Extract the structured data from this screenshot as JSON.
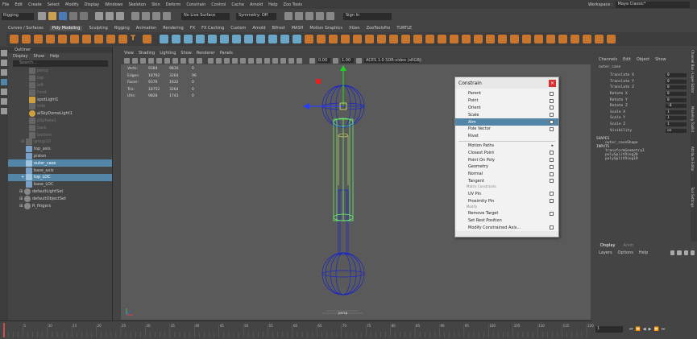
{
  "menubar": {
    "items": [
      "File",
      "Edit",
      "Create",
      "Select",
      "Modify",
      "Display",
      "Windows",
      "Skeleton",
      "Skin",
      "Deform",
      "Constrain",
      "Control",
      "Cache",
      "Arnold",
      "Help",
      "Zoo Tools"
    ],
    "workspace_label": "Workspace :",
    "workspace_value": "Maya Classic*"
  },
  "statusline": {
    "mode": "Rigging",
    "live_surface": "No Live Surface",
    "symmetry": "Symmetry: Off",
    "sign_in": "Sign In"
  },
  "shelf": {
    "tabs": [
      "Curves / Surfaces",
      "Poly Modeling",
      "Sculpting",
      "Rigging",
      "Animation",
      "Rendering",
      "FX",
      "FX Caching",
      "Custom",
      "Arnold",
      "Bifrost",
      "MASH",
      "Motion Graphics",
      "XGen",
      "ZooToolsPro",
      "TURTLE"
    ],
    "active": "Poly Modeling"
  },
  "outliner": {
    "title": "Outliner",
    "menu": [
      "Display",
      "Show",
      "Help"
    ],
    "search_placeholder": "Search...",
    "items": [
      {
        "label": "persp",
        "dim": true
      },
      {
        "label": "top",
        "dim": true
      },
      {
        "label": "left",
        "dim": true
      },
      {
        "label": "front",
        "dim": true
      },
      {
        "label": "spotLight1",
        "dim": false
      },
      {
        "label": "side",
        "dim": true
      },
      {
        "label": "aiSkyDomeLight1",
        "dim": false
      },
      {
        "label": "pSphere1",
        "dim": true
      },
      {
        "label": "back",
        "dim": true
      },
      {
        "label": "bottom",
        "dim": true
      },
      {
        "label": "group10",
        "dim": true
      },
      {
        "label": "top_axis",
        "dim": false
      },
      {
        "label": "piston",
        "dim": false
      },
      {
        "label": "outer_case",
        "dim": false,
        "selected": true
      },
      {
        "label": "base_axis",
        "dim": false
      },
      {
        "label": "top_LOC",
        "dim": false,
        "selected": true
      },
      {
        "label": "base_LOC",
        "dim": false
      },
      {
        "label": "defaultLightSet",
        "dim": false
      },
      {
        "label": "defaultObjectSet",
        "dim": false
      },
      {
        "label": "R_fingers",
        "dim": false
      }
    ]
  },
  "viewport": {
    "menu": [
      "View",
      "Shading",
      "Lighting",
      "Show",
      "Renderer",
      "Panels"
    ],
    "near_value": "0.00",
    "far_value": "1.00",
    "color_space": "ACES 1.0 SDR-video (sRGB)",
    "hud": [
      {
        "label": "Verts:",
        "a": "9384",
        "b": "9816",
        "c": "0"
      },
      {
        "label": "Edges:",
        "a": "18792",
        "b": "3264",
        "c": "96"
      },
      {
        "label": "Faces:",
        "a": "9376",
        "b": "1632",
        "c": "0"
      },
      {
        "label": "Tris:",
        "a": "18752",
        "b": "3264",
        "c": "0"
      },
      {
        "label": "UVs:",
        "a": "9828",
        "b": "1743",
        "c": "0"
      }
    ],
    "camera_label": "persp"
  },
  "constrain_menu": {
    "title": "Constrain",
    "items": [
      {
        "label": "Parent",
        "type": "item"
      },
      {
        "label": "Point",
        "type": "item"
      },
      {
        "label": "Orient",
        "type": "item"
      },
      {
        "label": "Scale",
        "type": "item"
      },
      {
        "label": "Aim",
        "type": "item",
        "highlight": true
      },
      {
        "label": "Pole Vector",
        "type": "item"
      },
      {
        "label": "Rivet",
        "type": "item"
      },
      {
        "label": "Motion Paths",
        "type": "submenu"
      },
      {
        "label": "Closest Point",
        "type": "item"
      },
      {
        "label": "Point On Poly",
        "type": "item"
      },
      {
        "label": "Geometry",
        "type": "item"
      },
      {
        "label": "Normal",
        "type": "item"
      },
      {
        "label": "Tangent",
        "type": "item"
      },
      {
        "label": "Matrix Constraints",
        "type": "section"
      },
      {
        "label": "UV Pin",
        "type": "item"
      },
      {
        "label": "Proximity Pin",
        "type": "item"
      },
      {
        "label": "Modify",
        "type": "section"
      },
      {
        "label": "Remove Target",
        "type": "item"
      },
      {
        "label": "Set Rest Position",
        "type": "item"
      },
      {
        "label": "Modify Constrained Axis...",
        "type": "submenu"
      }
    ]
  },
  "channelbox": {
    "menu": [
      "Channels",
      "Edit",
      "Object",
      "Show"
    ],
    "object": "outer_case",
    "channels": [
      {
        "name": "Translate X",
        "value": "0"
      },
      {
        "name": "Translate Y",
        "value": "0"
      },
      {
        "name": "Translate Z",
        "value": "0"
      },
      {
        "name": "Rotate X",
        "value": "0"
      },
      {
        "name": "Rotate Y",
        "value": "0"
      },
      {
        "name": "Rotate Z",
        "value": "-0"
      },
      {
        "name": "Scale X",
        "value": "1"
      },
      {
        "name": "Scale Y",
        "value": "1"
      },
      {
        "name": "Scale Z",
        "value": "1"
      },
      {
        "name": "Visibility",
        "value": "on"
      }
    ],
    "shapes_label": "SHAPES",
    "shape": "outer_caseShape",
    "inputs_label": "INPUTS",
    "inputs": [
      "transformGeometry1",
      "polySplitRing20",
      "polySplitRing19"
    ],
    "side_tabs": [
      "Channel Box / Layer Editor",
      "Modeling Toolkit",
      "Attribute Editor",
      "Tool Settings"
    ]
  },
  "layer_editor": {
    "tabs": [
      "Display",
      "Anim"
    ],
    "menu": [
      "Layers",
      "Options",
      "Help"
    ]
  },
  "timeline": {
    "ticks": [
      "5",
      "10",
      "15",
      "20",
      "25",
      "30",
      "35",
      "40",
      "45",
      "50",
      "55",
      "60",
      "65",
      "70",
      "75",
      "80",
      "85",
      "90",
      "95",
      "100",
      "105",
      "110",
      "115",
      "120"
    ],
    "current_frame": "1"
  },
  "colors": {
    "accent": "#5285a6",
    "shelf_icon": "#c8752e",
    "wire": "#1a24c8",
    "wire_selected": "#6bff6b"
  }
}
